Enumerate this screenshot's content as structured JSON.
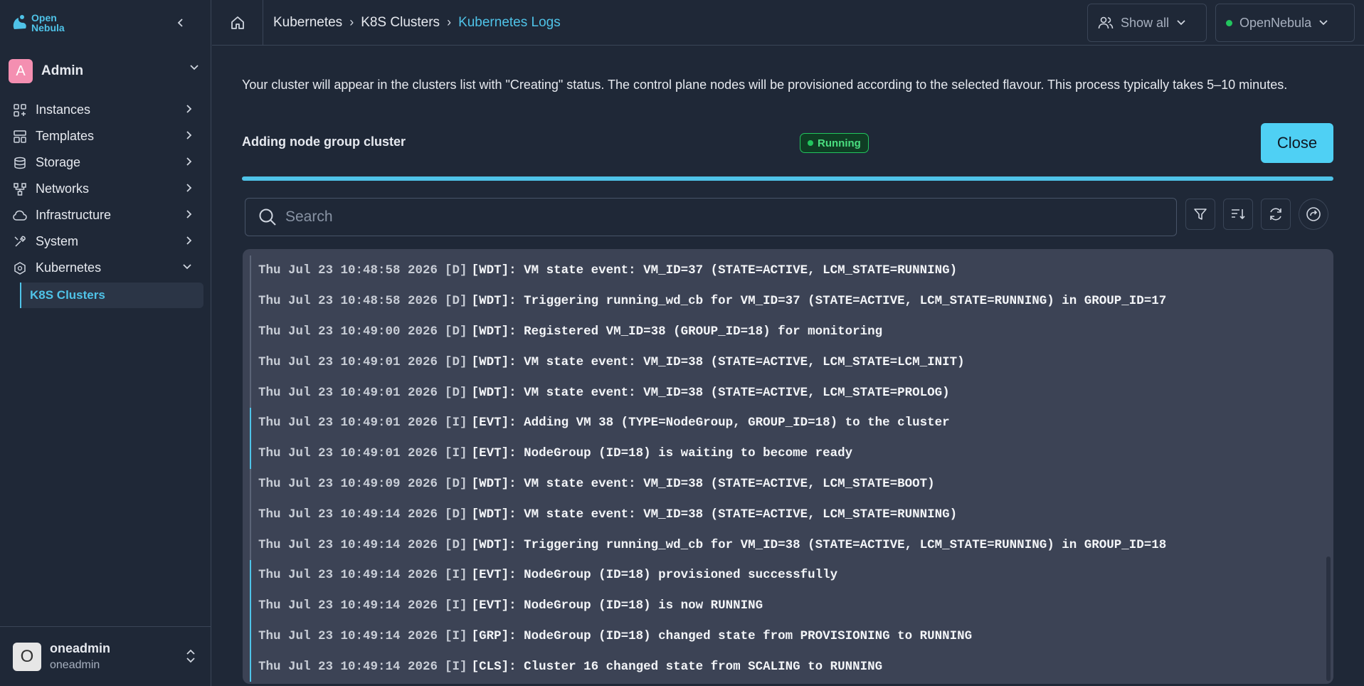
{
  "brand": {
    "line1": "Open",
    "line2": "Nebula",
    "accent": "#4fc3e8"
  },
  "sidebar": {
    "user_initial": "A",
    "user_label": "Admin",
    "items": [
      {
        "label": "Instances",
        "icon": "instances-icon"
      },
      {
        "label": "Templates",
        "icon": "templates-icon"
      },
      {
        "label": "Storage",
        "icon": "storage-icon"
      },
      {
        "label": "Networks",
        "icon": "networks-icon"
      },
      {
        "label": "Infrastructure",
        "icon": "cloud-icon"
      },
      {
        "label": "System",
        "icon": "system-icon"
      },
      {
        "label": "Kubernetes",
        "icon": "kubernetes-icon"
      }
    ],
    "sub_item": "K8S Clusters",
    "footer": {
      "initial": "O",
      "name": "oneadmin",
      "group": "oneadmin"
    }
  },
  "topbar": {
    "breadcrumb": [
      "Kubernetes",
      "K8S Clusters",
      "Kubernetes Logs"
    ],
    "show_all": "Show all",
    "zone": "OpenNebula"
  },
  "main": {
    "info": "Your cluster will appear in the clusters list with \"Creating\" status. The control plane nodes will be provisioned according to the selected flavour. This process typically takes 5–10 minutes.",
    "task_label": "Adding node group cluster",
    "status": "Running",
    "close_label": "Close",
    "progress_pct": 100,
    "search_placeholder": "Search"
  },
  "logs": [
    {
      "ts": "Thu Jul 23 10:48:58 2026",
      "level": "[D]",
      "msg": "[WDT]: VM state event: VM_ID=37 (STATE=ACTIVE, LCM_STATE=RUNNING)"
    },
    {
      "ts": "Thu Jul 23 10:48:58 2026",
      "level": "[D]",
      "msg": "[WDT]: Triggering running_wd_cb for VM_ID=37 (STATE=ACTIVE, LCM_STATE=RUNNING) in GROUP_ID=17"
    },
    {
      "ts": "Thu Jul 23 10:49:00 2026",
      "level": "[D]",
      "msg": "[WDT]: Registered VM_ID=38 (GROUP_ID=18) for monitoring"
    },
    {
      "ts": "Thu Jul 23 10:49:01 2026",
      "level": "[D]",
      "msg": "[WDT]: VM state event: VM_ID=38 (STATE=ACTIVE, LCM_STATE=LCM_INIT)"
    },
    {
      "ts": "Thu Jul 23 10:49:01 2026",
      "level": "[D]",
      "msg": "[WDT]: VM state event: VM_ID=38 (STATE=ACTIVE, LCM_STATE=PROLOG)"
    },
    {
      "ts": "Thu Jul 23 10:49:01 2026",
      "level": "[I]",
      "msg": "[EVT]: Adding VM 38 (TYPE=NodeGroup, GROUP_ID=18) to the cluster"
    },
    {
      "ts": "Thu Jul 23 10:49:01 2026",
      "level": "[I]",
      "msg": "[EVT]: NodeGroup (ID=18) is waiting to become ready"
    },
    {
      "ts": "Thu Jul 23 10:49:09 2026",
      "level": "[D]",
      "msg": "[WDT]: VM state event: VM_ID=38 (STATE=ACTIVE, LCM_STATE=BOOT)"
    },
    {
      "ts": "Thu Jul 23 10:49:14 2026",
      "level": "[D]",
      "msg": "[WDT]: VM state event: VM_ID=38 (STATE=ACTIVE, LCM_STATE=RUNNING)"
    },
    {
      "ts": "Thu Jul 23 10:49:14 2026",
      "level": "[D]",
      "msg": "[WDT]: Triggering running_wd_cb for VM_ID=38 (STATE=ACTIVE, LCM_STATE=RUNNING) in GROUP_ID=18"
    },
    {
      "ts": "Thu Jul 23 10:49:14 2026",
      "level": "[I]",
      "msg": "[EVT]: NodeGroup (ID=18) provisioned successfully"
    },
    {
      "ts": "Thu Jul 23 10:49:14 2026",
      "level": "[I]",
      "msg": "[EVT]: NodeGroup (ID=18) is now RUNNING"
    },
    {
      "ts": "Thu Jul 23 10:49:14 2026",
      "level": "[I]",
      "msg": "[GRP]: NodeGroup (ID=18) changed state from PROVISIONING to RUNNING"
    },
    {
      "ts": "Thu Jul 23 10:49:14 2026",
      "level": "[I]",
      "msg": "[CLS]: Cluster 16 changed state from SCALING to RUNNING"
    }
  ]
}
